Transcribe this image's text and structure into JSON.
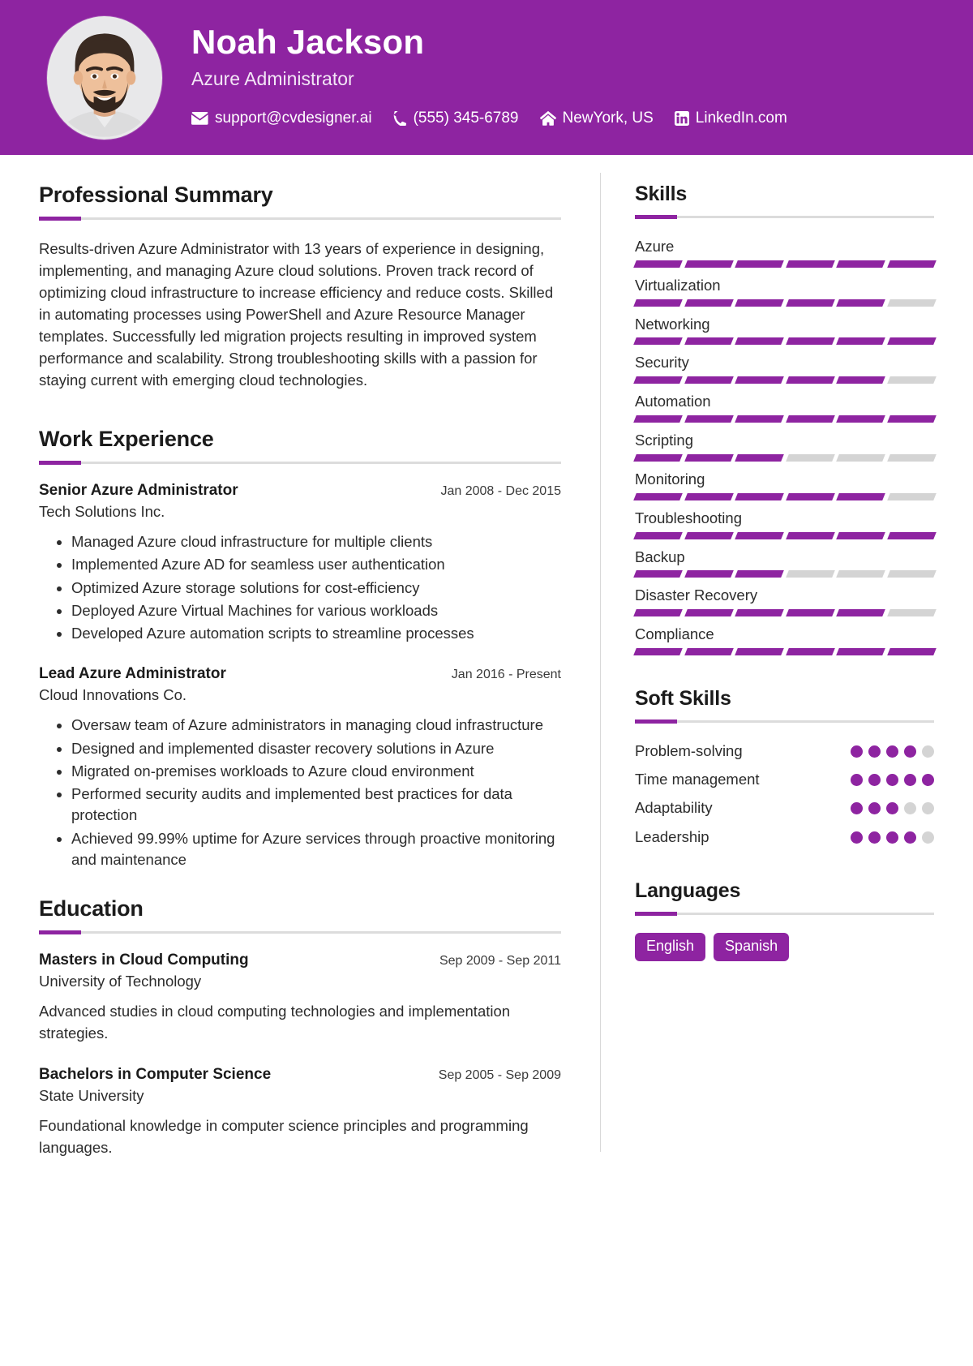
{
  "theme": {
    "accent": "#8e24a1",
    "track": "#d4d4d4",
    "text": "#2c2c2c",
    "rule": "#dcdcdc"
  },
  "header": {
    "name": "Noah Jackson",
    "title": "Azure Administrator",
    "contacts": [
      {
        "icon": "envelope-icon",
        "label": "support@cvdesigner.ai"
      },
      {
        "icon": "phone-icon",
        "label": "(555) 345-6789"
      },
      {
        "icon": "home-icon",
        "label": "NewYork, US"
      },
      {
        "icon": "linkedin-icon",
        "label": "LinkedIn.com"
      }
    ]
  },
  "summary": {
    "heading": "Professional Summary",
    "text": "Results-driven Azure Administrator with 13 years of experience in designing, implementing, and managing Azure cloud solutions. Proven track record of optimizing cloud infrastructure to increase efficiency and reduce costs. Skilled in automating processes using PowerShell and Azure Resource Manager templates. Successfully led migration projects resulting in improved system performance and scalability. Strong troubleshooting skills with a passion for staying current with emerging cloud technologies."
  },
  "work": {
    "heading": "Work Experience",
    "entries": [
      {
        "role": "Senior Azure Administrator",
        "date": "Jan 2008 - Dec 2015",
        "org": "Tech Solutions Inc.",
        "bullets": [
          "Managed Azure cloud infrastructure for multiple clients",
          "Implemented Azure AD for seamless user authentication",
          "Optimized Azure storage solutions for cost-efficiency",
          "Deployed Azure Virtual Machines for various workloads",
          "Developed Azure automation scripts to streamline processes"
        ]
      },
      {
        "role": "Lead Azure Administrator",
        "date": "Jan 2016 - Present",
        "org": "Cloud Innovations Co.",
        "bullets": [
          "Oversaw team of Azure administrators in managing cloud infrastructure",
          "Designed and implemented disaster recovery solutions in Azure",
          "Migrated on-premises workloads to Azure cloud environment",
          "Performed security audits and implemented best practices for data protection",
          "Achieved 99.99% uptime for Azure services through proactive monitoring and maintenance"
        ]
      }
    ]
  },
  "education": {
    "heading": "Education",
    "entries": [
      {
        "degree": "Masters in Cloud Computing",
        "date": "Sep 2009 - Sep 2011",
        "school": "University of Technology",
        "desc": "Advanced studies in cloud computing technologies and implementation strategies."
      },
      {
        "degree": "Bachelors in Computer Science",
        "date": "Sep 2005 - Sep 2009",
        "school": "State University",
        "desc": "Foundational knowledge in computer science principles and programming languages."
      }
    ]
  },
  "skills": {
    "heading": "Skills",
    "segments_total": 6,
    "items": [
      {
        "name": "Azure",
        "filled": 6
      },
      {
        "name": "Virtualization",
        "filled": 5
      },
      {
        "name": "Networking",
        "filled": 6
      },
      {
        "name": "Security",
        "filled": 5
      },
      {
        "name": "Automation",
        "filled": 6
      },
      {
        "name": "Scripting",
        "filled": 3
      },
      {
        "name": "Monitoring",
        "filled": 5
      },
      {
        "name": "Troubleshooting",
        "filled": 6
      },
      {
        "name": "Backup",
        "filled": 3
      },
      {
        "name": "Disaster Recovery",
        "filled": 5
      },
      {
        "name": "Compliance",
        "filled": 6
      }
    ]
  },
  "soft_skills": {
    "heading": "Soft Skills",
    "dots_total": 5,
    "items": [
      {
        "name": "Problem-solving",
        "filled": 4
      },
      {
        "name": "Time management",
        "filled": 5
      },
      {
        "name": "Adaptability",
        "filled": 3
      },
      {
        "name": "Leadership",
        "filled": 4
      }
    ]
  },
  "languages": {
    "heading": "Languages",
    "items": [
      "English",
      "Spanish"
    ]
  }
}
